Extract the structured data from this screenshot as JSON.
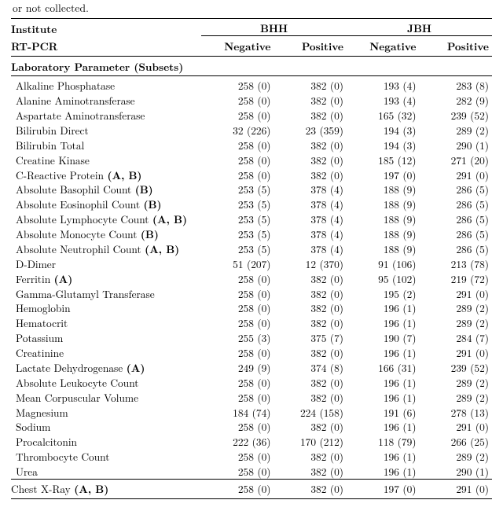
{
  "cutoff_text": "or not collected.",
  "header": {
    "row1": {
      "left": "Institute",
      "g1": "BHH",
      "g2": "JBH"
    },
    "row2": {
      "left": "RT-PCR",
      "c1": "Negative",
      "c2": "Positive",
      "c3": "Negative",
      "c4": "Positive"
    }
  },
  "section_label": "Laboratory Parameter (Subsets)",
  "rows": [
    {
      "label": "Alkaline Phosphatase",
      "v": [
        "258 (0)",
        "382 (0)",
        "193 (4)",
        "283 (8)"
      ]
    },
    {
      "label": "Alanine Aminotransferase",
      "v": [
        "258 (0)",
        "382 (0)",
        "193 (4)",
        "282 (9)"
      ]
    },
    {
      "label": "Aspartate Aminotransferase",
      "v": [
        "258 (0)",
        "382 (0)",
        "165 (32)",
        "239 (52)"
      ]
    },
    {
      "label": "Bilirubin Direct",
      "v": [
        "32 (226)",
        "23 (359)",
        "194 (3)",
        "289 (2)"
      ]
    },
    {
      "label": "Bilirubin Total",
      "v": [
        "258 (0)",
        "382 (0)",
        "194 (3)",
        "290 (1)"
      ]
    },
    {
      "label": "Creatine Kinase",
      "v": [
        "258 (0)",
        "382 (0)",
        "185 (12)",
        "271 (20)"
      ]
    },
    {
      "label_html": "C-Reactive Protein <b>(A, B)</b>",
      "v": [
        "258 (0)",
        "382 (0)",
        "197 (0)",
        "291 (0)"
      ]
    },
    {
      "label_html": "Absolute Basophil Count <b>(B)</b>",
      "v": [
        "253 (5)",
        "378 (4)",
        "188 (9)",
        "286 (5)"
      ]
    },
    {
      "label_html": "Absolute Eosinophil Count <b>(B)</b>",
      "v": [
        "253 (5)",
        "378 (4)",
        "188 (9)",
        "286 (5)"
      ]
    },
    {
      "label_html": "Absolute Lymphocyte Count <b>(A, B)</b>",
      "v": [
        "253 (5)",
        "378 (4)",
        "188 (9)",
        "286 (5)"
      ]
    },
    {
      "label_html": "Absolute Monocyte Count <b>(B)</b>",
      "v": [
        "253 (5)",
        "378 (4)",
        "188 (9)",
        "286 (5)"
      ]
    },
    {
      "label_html": "Absolute Neutrophil Count <b>(A, B)</b>",
      "v": [
        "253 (5)",
        "378 (4)",
        "188 (9)",
        "286 (5)"
      ]
    },
    {
      "label": "D-Dimer",
      "v": [
        "51 (207)",
        "12 (370)",
        "91 (106)",
        "213 (78)"
      ]
    },
    {
      "label_html": "Ferritin <b>(A)</b>",
      "v": [
        "258 (0)",
        "382 (0)",
        "95 (102)",
        "219 (72)"
      ]
    },
    {
      "label": "Gamma-Glutamyl Transferase",
      "v": [
        "258 (0)",
        "382 (0)",
        "195 (2)",
        "291 (0)"
      ]
    },
    {
      "label": "Hemoglobin",
      "v": [
        "258 (0)",
        "382 (0)",
        "196 (1)",
        "289 (2)"
      ]
    },
    {
      "label": "Hematocrit",
      "v": [
        "258 (0)",
        "382 (0)",
        "196 (1)",
        "289 (2)"
      ]
    },
    {
      "label": "Potassium",
      "v": [
        "255 (3)",
        "375 (7)",
        "190 (7)",
        "284 (7)"
      ]
    },
    {
      "label": "Creatinine",
      "v": [
        "258 (0)",
        "382 (0)",
        "196 (1)",
        "291 (0)"
      ]
    },
    {
      "label_html": "Lactate Dehydrogenase <b>(A)</b>",
      "v": [
        "249 (9)",
        "374 (8)",
        "166 (31)",
        "239 (52)"
      ]
    },
    {
      "label": "Absolute Leukocyte Count",
      "v": [
        "258 (0)",
        "382 (0)",
        "196 (1)",
        "289 (2)"
      ]
    },
    {
      "label": "Mean Corpuscular Volume",
      "v": [
        "258 (0)",
        "382 (0)",
        "196 (1)",
        "289 (2)"
      ]
    },
    {
      "label": "Magnesium",
      "v": [
        "184 (74)",
        "224 (158)",
        "191 (6)",
        "278 (13)"
      ]
    },
    {
      "label": "Sodium",
      "v": [
        "258 (0)",
        "382 (0)",
        "196 (1)",
        "291 (0)"
      ]
    },
    {
      "label": "Procalcitonin",
      "v": [
        "222 (36)",
        "170 (212)",
        "118 (79)",
        "266 (25)"
      ]
    },
    {
      "label": "Thrombocyte Count",
      "v": [
        "258 (0)",
        "382 (0)",
        "196 (1)",
        "289 (2)"
      ]
    },
    {
      "label": "Urea",
      "v": [
        "258 (0)",
        "382 (0)",
        "196 (1)",
        "290 (1)"
      ]
    }
  ],
  "footer_row": {
    "label_html": "Chest X-Ray <b>(A, B)</b>",
    "v": [
      "258 (0)",
      "382 (0)",
      "197 (0)",
      "291 (0)"
    ]
  }
}
